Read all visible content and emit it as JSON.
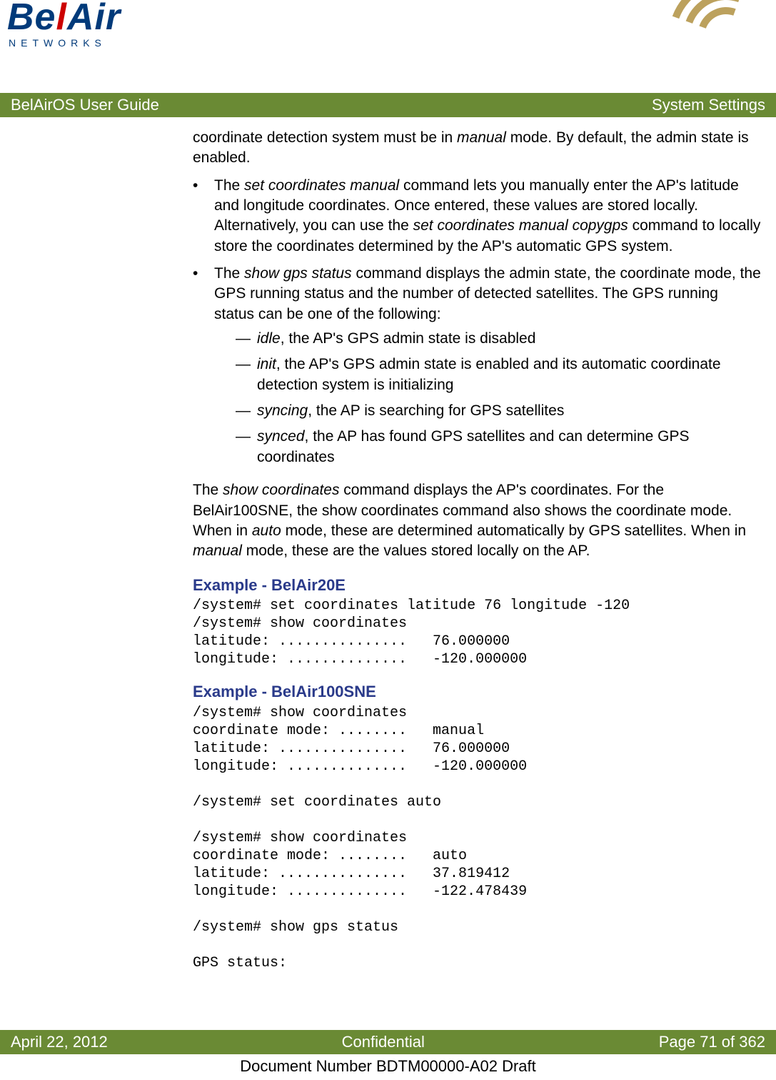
{
  "logo": {
    "text": "BelAir",
    "sub": "NETWORKS"
  },
  "topbar": {
    "left": "BelAirOS User Guide",
    "right": "System Settings"
  },
  "body": {
    "intro_tail": "coordinate detection system must be in ",
    "intro_tail_em": "manual",
    "intro_tail2": " mode. By default, the admin state is enabled.",
    "bullet1_a": "The ",
    "bullet1_em1": "set coordinates manual",
    "bullet1_b": " command lets you manually enter the AP's latitude and longitude coordinates. Once entered, these values are stored locally. Alternatively, you can use the ",
    "bullet1_em2": "set coordinates manual copygps",
    "bullet1_c": " command to locally store the coordinates determined by the AP's automatic GPS system.",
    "bullet2_a": "The ",
    "bullet2_em1": "show gps status",
    "bullet2_b": " command displays the admin state, the coordinate mode, the GPS running status and the number of detected satellites. The GPS running status can be one of the following:",
    "dash1_em": "idle",
    "dash1_t": ", the AP's GPS admin state is disabled",
    "dash2_em": "init",
    "dash2_t": ", the AP's GPS admin state is enabled and its automatic coordinate detection system is initializing",
    "dash3_em": "syncing",
    "dash3_t": ", the AP is searching for GPS satellites",
    "dash4_em": "synced",
    "dash4_t": ", the AP has found GPS satellites and can determine GPS coordinates",
    "para2_a": "The ",
    "para2_em1": "show coordinates",
    "para2_b": " command displays the AP's coordinates. For the BelAir100SNE, the show coordinates command also shows the coordinate mode. When in ",
    "para2_em2": "auto",
    "para2_c": " mode, these are determined automatically by GPS satellites. When in ",
    "para2_em3": "manual",
    "para2_d": " mode, these are the values stored locally on the AP.",
    "ex1_heading": "Example - BelAir20E",
    "ex1_code": "/system# set coordinates latitude 76 longitude -120\n/system# show coordinates\nlatitude: ...............   76.000000\nlongitude: ..............   -120.000000",
    "ex2_heading": "Example - BelAir100SNE",
    "ex2_code": "/system# show coordinates\ncoordinate mode: ........   manual\nlatitude: ...............   76.000000\nlongitude: ..............   -120.000000\n\n/system# set coordinates auto\n\n/system# show coordinates\ncoordinate mode: ........   auto\nlatitude: ...............   37.819412\nlongitude: ..............   -122.478439\n\n/system# show gps status\n\nGPS status:"
  },
  "footer": {
    "date": "April 22, 2012",
    "center": "Confidential",
    "page": "Page 71 of 362",
    "docnum": "Document Number BDTM00000-A02 Draft"
  }
}
